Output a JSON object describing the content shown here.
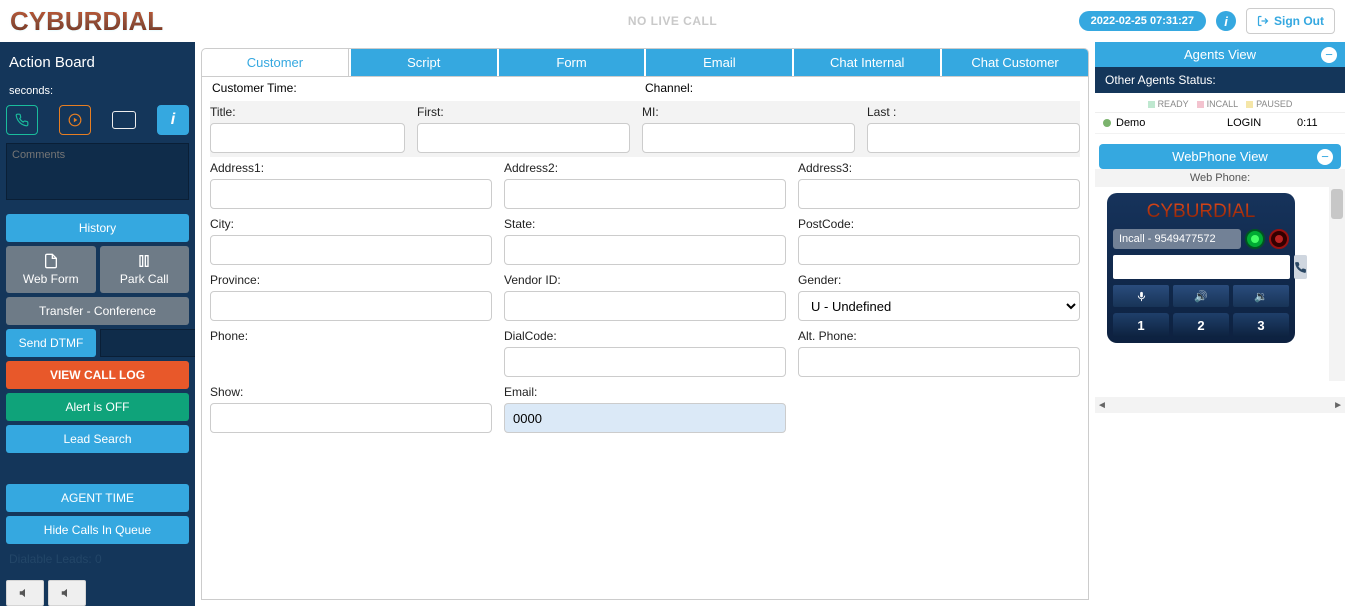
{
  "top": {
    "logo": "CYBURDIAL",
    "center": "NO LIVE CALL",
    "timestamp": "2022-02-25 07:31:27",
    "signout": "Sign Out"
  },
  "left": {
    "title": "Action Board",
    "seconds_label": "seconds:",
    "comments_placeholder": "Comments",
    "history": "History",
    "webform": "Web Form",
    "parkcall": "Park Call",
    "transfer": "Transfer - Conference",
    "senddtmf": "Send DTMF",
    "viewlog": "VIEW CALL LOG",
    "alert": "Alert is OFF",
    "leadsearch": "Lead Search",
    "agenttime": "AGENT TIME",
    "hidecalls": "Hide Calls In Queue",
    "dialable": "Dialable Leads:  0"
  },
  "tabs": {
    "customer": "Customer",
    "script": "Script",
    "form": "Form",
    "email": "Email",
    "chat_internal": "Chat Internal",
    "chat_customer": "Chat Customer"
  },
  "form": {
    "customer_time": "Customer Time:",
    "channel": "Channel:",
    "title": "Title:",
    "first": "First:",
    "mi": "MI:",
    "last": "Last :",
    "address1": "Address1:",
    "address2": "Address2:",
    "address3": "Address3:",
    "city": "City:",
    "state": "State:",
    "postcode": "PostCode:",
    "province": "Province:",
    "vendorid": "Vendor ID:",
    "gender": "Gender:",
    "gender_value": "U - Undefined",
    "phone": "Phone:",
    "dialcode": "DialCode:",
    "altphone": "Alt. Phone:",
    "show": "Show:",
    "email": "Email:",
    "email_value": "0000"
  },
  "right": {
    "agents_view": "Agents View",
    "other_status": "Other Agents Status:",
    "ready": "READY",
    "incall": "INCALL",
    "paused": "PAUSED",
    "agent_name": "Demo",
    "agent_state": "LOGIN",
    "agent_time": "0:11",
    "webphone_view": "WebPhone View",
    "webphone_title": "Web Phone:",
    "wp_logo": "CYBURDIAL",
    "wp_status": "Incall - 9549477572",
    "k1": "1",
    "k2": "2",
    "k3": "3"
  }
}
